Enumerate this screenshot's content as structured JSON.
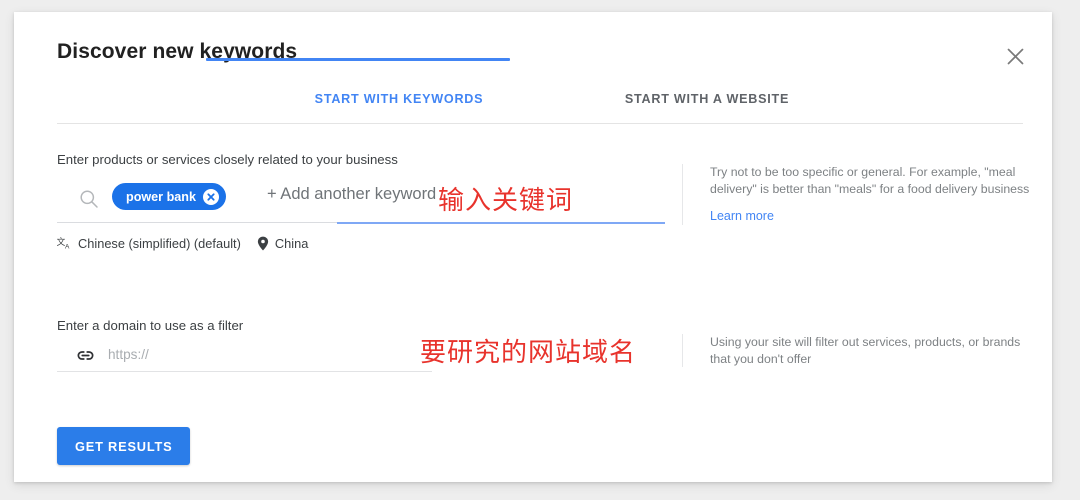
{
  "dialog": {
    "title": "Discover new keywords",
    "close_icon": "close-icon"
  },
  "tabs": [
    {
      "label": "START WITH KEYWORDS",
      "active": true
    },
    {
      "label": "START WITH A WEBSITE",
      "active": false
    }
  ],
  "keywords_section": {
    "label": "Enter products or services closely related to your business",
    "search_icon": "search-icon",
    "chips": [
      {
        "label": "power bank",
        "remove_icon": "close-circle-icon"
      }
    ],
    "add_another": "+ Add another keyword",
    "language": {
      "icon": "translate-icon",
      "label": "Chinese (simplified) (default)"
    },
    "location": {
      "icon": "location-pin-icon",
      "label": "China"
    },
    "help": {
      "text": "Try not to be too specific or general. For example, \"meal delivery\" is better than \"meals\" for a food delivery business",
      "link": "Learn more"
    }
  },
  "domain_section": {
    "label": "Enter a domain to use as a filter",
    "link_icon": "link-icon",
    "input_value": "",
    "input_placeholder": "https://",
    "help": {
      "text": "Using your site will filter out services, products, or brands that you don't offer"
    }
  },
  "submit": {
    "label": "GET RESULTS"
  },
  "annotations": [
    {
      "text": "输入关键词",
      "color": "#e8332c"
    },
    {
      "text": "要研究的网站域名",
      "color": "#e8332c"
    }
  ],
  "colors": {
    "accent_blue": "#4285f4",
    "chip_blue": "#1b72e8",
    "button_blue": "#2b7de9",
    "annotation_red": "#e8332c",
    "page_background": "#eeeeee"
  }
}
